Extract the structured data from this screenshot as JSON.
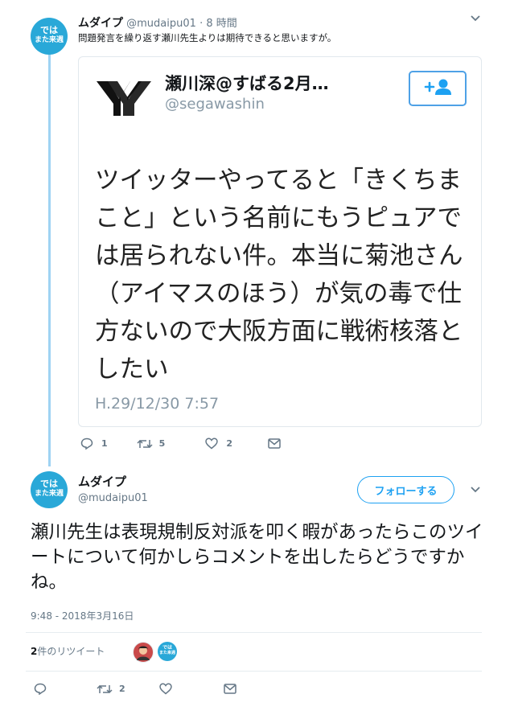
{
  "reply": {
    "avatar": {
      "line1": "では",
      "line2": "また来週"
    },
    "name": "ムダイプ",
    "handle": "@mudaipu01",
    "time": "· 8 時間",
    "text": "問題発言を繰り返す瀬川先生よりは期待できると思いますが。",
    "quote": {
      "logo": "YY",
      "name": "瀬川深@すばる2月…",
      "handle": "@segawashin",
      "body": "ツイッターやってると「きくちまこと」という名前にもうピュアでは居られない件。本当に菊池さん（アイマスのほう）が気の毒で仕方ないので大阪方面に戦術核落としたい",
      "date": "H.29/12/30 7:57"
    },
    "actions": {
      "reply_count": "1",
      "retweet_count": "5",
      "like_count": "2"
    }
  },
  "main": {
    "avatar": {
      "line1": "では",
      "line2": "また来週"
    },
    "name": "ムダイプ",
    "handle": "@mudaipu01",
    "follow_label": "フォローする",
    "text": "瀬川先生は表現規制反対派を叩く暇があったらこのツイートについて何かしらコメントを出したらどうですかね。",
    "timestamp": "9:48 - 2018年3月16日",
    "retweets": {
      "count": "2",
      "label": "件のリツイート"
    },
    "actions": {
      "retweet_count": "2"
    }
  },
  "colors": {
    "accent": "#1da1f2",
    "avatar_bg": "#29a8d8",
    "thread_line": "#9fd3f3",
    "muted": "#657786"
  }
}
